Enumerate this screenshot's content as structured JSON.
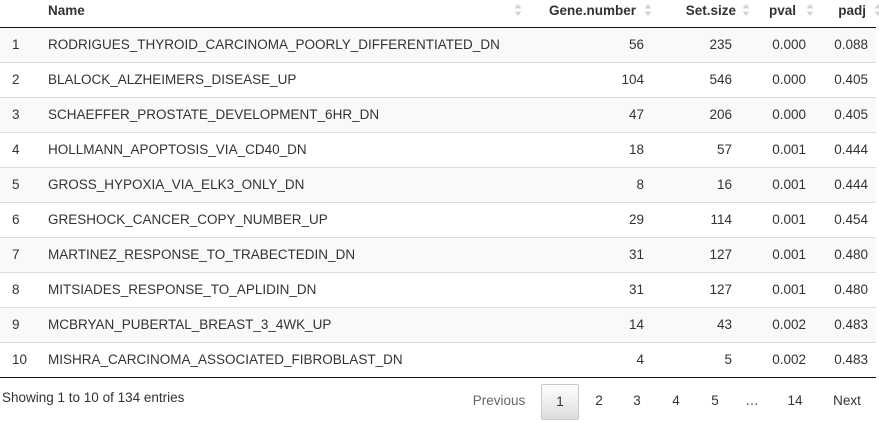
{
  "table": {
    "headers": {
      "index": "",
      "name": "Name",
      "gene_number": "Gene.number",
      "set_size": "Set.size",
      "pval": "pval",
      "padj": "padj"
    },
    "rows": [
      {
        "index": "1",
        "name": "RODRIGUES_THYROID_CARCINOMA_POORLY_DIFFERENTIATED_DN",
        "gene_number": "56",
        "set_size": "235",
        "pval": "0.000",
        "padj": "0.088"
      },
      {
        "index": "2",
        "name": "BLALOCK_ALZHEIMERS_DISEASE_UP",
        "gene_number": "104",
        "set_size": "546",
        "pval": "0.000",
        "padj": "0.405"
      },
      {
        "index": "3",
        "name": "SCHAEFFER_PROSTATE_DEVELOPMENT_6HR_DN",
        "gene_number": "47",
        "set_size": "206",
        "pval": "0.000",
        "padj": "0.405"
      },
      {
        "index": "4",
        "name": "HOLLMANN_APOPTOSIS_VIA_CD40_DN",
        "gene_number": "18",
        "set_size": "57",
        "pval": "0.001",
        "padj": "0.444"
      },
      {
        "index": "5",
        "name": "GROSS_HYPOXIA_VIA_ELK3_ONLY_DN",
        "gene_number": "8",
        "set_size": "16",
        "pval": "0.001",
        "padj": "0.444"
      },
      {
        "index": "6",
        "name": "GRESHOCK_CANCER_COPY_NUMBER_UP",
        "gene_number": "29",
        "set_size": "114",
        "pval": "0.001",
        "padj": "0.454"
      },
      {
        "index": "7",
        "name": "MARTINEZ_RESPONSE_TO_TRABECTEDIN_DN",
        "gene_number": "31",
        "set_size": "127",
        "pval": "0.001",
        "padj": "0.480"
      },
      {
        "index": "8",
        "name": "MITSIADES_RESPONSE_TO_APLIDIN_DN",
        "gene_number": "31",
        "set_size": "127",
        "pval": "0.001",
        "padj": "0.480"
      },
      {
        "index": "9",
        "name": "MCBRYAN_PUBERTAL_BREAST_3_4WK_UP",
        "gene_number": "14",
        "set_size": "43",
        "pval": "0.002",
        "padj": "0.483"
      },
      {
        "index": "10",
        "name": "MISHRA_CARCINOMA_ASSOCIATED_FIBROBLAST_DN",
        "gene_number": "4",
        "set_size": "5",
        "pval": "0.002",
        "padj": "0.483"
      }
    ]
  },
  "footer": {
    "info": "Showing 1 to 10 of 134 entries"
  },
  "pagination": {
    "previous": "Previous",
    "pages": [
      "1",
      "2",
      "3",
      "4",
      "5",
      "…",
      "14"
    ],
    "current": "1",
    "next": "Next"
  },
  "colors": {
    "stripe": "#f9f9f9",
    "row_border": "#dddddd",
    "header_border": "#111111",
    "sort_icon": "#d3d3d3"
  },
  "icons": {
    "sort": "sort-both-icon"
  }
}
